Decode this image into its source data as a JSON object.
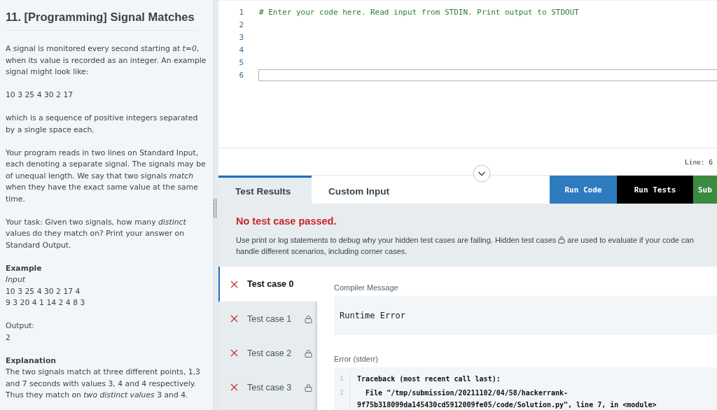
{
  "problem": {
    "title": "11. [Programming] Signal Matches",
    "paragraphs": [
      "A signal is monitored every second starting at *t=0*, when its value is recorded as an integer. An example signal might look like:",
      "10 3 25 4 30 2 17",
      "which is a sequence of positive integers separated by a single space each.",
      "Your program reads in two lines on Standard Input, each denoting a separate signal. The signals may be of unequal length. We say that two signals *match* when they have the exact same value at the same time.",
      "Your task: Given two signals, how many *distinct* values do they match on? Print your answer on Standard Output."
    ],
    "example_heading": "Example",
    "input_label": "Input",
    "input_lines": [
      "10 3 25 4 30 2 17 4",
      "9 3 20 4 1 14 2 4 8 3"
    ],
    "output_label": "Output:",
    "output": "2",
    "explanation_heading": "Explanation",
    "explanation": "The two signals match at three different points, 1,3 and 7 seconds with values 3, 4 and 4 respectively. Thus they match on *two distinct values* 3 and 4."
  },
  "editor": {
    "lines": [
      {
        "number": "1",
        "text": "# Enter your code here. Read input from STDIN. Print output to STDOUT",
        "active": false
      },
      {
        "number": "2",
        "active": false
      },
      {
        "number": "3",
        "active": false
      },
      {
        "number": "4",
        "active": false
      },
      {
        "number": "5",
        "active": false
      },
      {
        "number": "6",
        "active": true
      }
    ],
    "status": "Line: 6"
  },
  "tabs": [
    {
      "label": "Test Results",
      "selected": true
    },
    {
      "label": "Custom Input",
      "selected": false
    }
  ],
  "buttons": [
    {
      "label": "Run Code",
      "kind": "run"
    },
    {
      "label": "Run Tests",
      "kind": "tests"
    },
    {
      "label": "Sub",
      "kind": "submit"
    }
  ],
  "results": {
    "headline": "No test case passed.",
    "note_before": "Use print or log statements to debug why your hidden test cases are failing. Hidden test cases",
    "note_after": "are used to evaluate if your code can",
    "note_end": "handle different scenarios, including corner cases.",
    "cases": [
      {
        "label": "Test case 0",
        "selected": true,
        "locked": false,
        "passed": false
      },
      {
        "label": "Test case 1",
        "selected": false,
        "locked": true,
        "passed": false
      },
      {
        "label": "Test case 2",
        "selected": false,
        "locked": true,
        "passed": false
      },
      {
        "label": "Test case 3",
        "selected": false,
        "locked": true,
        "passed": false
      }
    ],
    "compiler_label": "Compiler Message",
    "compiler_message": "Runtime Error",
    "stderr_label": "Error (stderr)",
    "stderr_lines": [
      {
        "number": "1",
        "text": "Traceback (most recent call last):"
      },
      {
        "number": "2",
        "text": "  File \"/tmp/submission/20211102/04/58/hackerrank-9f75b318099da145430cd5912009fe05/code/Solution.py\", line 7, in <module>"
      }
    ]
  }
}
